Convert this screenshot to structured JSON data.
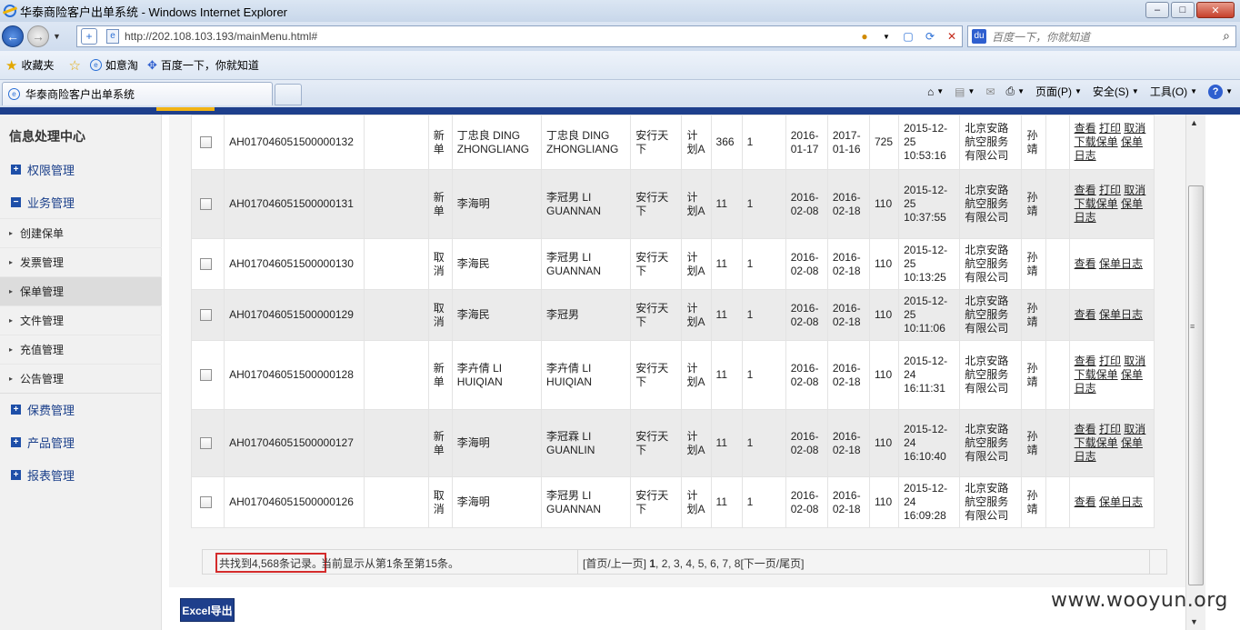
{
  "window": {
    "title": "华泰商险客户出单系统 - Windows Internet Explorer",
    "controls": [
      "–",
      "□",
      "✕"
    ]
  },
  "address_bar": {
    "url": "http://202.108.103.193/mainMenu.html#"
  },
  "search_bar": {
    "placeholder": "百度一下，你就知道"
  },
  "favorites": {
    "favorites_label": "收藏夹",
    "items": [
      "如意淘",
      "百度一下，你就知道"
    ]
  },
  "tabs": {
    "active_tab": "华泰商险客户出单系统"
  },
  "command_bar": {
    "page": "页面(P)",
    "safety": "安全(S)",
    "tools": "工具(O)",
    "help": "?"
  },
  "sidebar": {
    "title": "信息处理中心",
    "groups": [
      {
        "label": "权限管理",
        "icon": "plus"
      },
      {
        "label": "业务管理",
        "icon": "minus"
      }
    ],
    "sub_items": [
      "创建保单",
      "发票管理",
      "保单管理",
      "文件管理",
      "充值管理",
      "公告管理"
    ],
    "active_sub": "保单管理",
    "groups_after": [
      "保费管理",
      "产品管理",
      "报表管理"
    ]
  },
  "table": {
    "rows": [
      {
        "policy_no": "AH017046051500000132",
        "type": "新单",
        "insured": "丁忠良 DING ZHONGLIANG",
        "holder": "丁忠良 DING ZHONGLIANG",
        "product": "安行天下",
        "plan": "计划A",
        "days": "366",
        "count": "1",
        "start": "2016-01-17",
        "end": "2017-01-16",
        "premium": "725",
        "created": "2015-12-25 10:53:16",
        "agency": "北京安路航空服务有限公司",
        "operator": "孙靖",
        "ops": [
          "查看",
          "打印",
          "取消",
          "下载保单",
          "保单日志"
        ]
      },
      {
        "policy_no": "AH017046051500000131",
        "type": "新单",
        "insured": "李海明",
        "holder": "李冠男 LI GUANNAN",
        "product": "安行天下",
        "plan": "计划A",
        "days": "11",
        "count": "1",
        "start": "2016-02-08",
        "end": "2016-02-18",
        "premium": "110",
        "created": "2015-12-25 10:37:55",
        "agency": "北京安路航空服务有限公司",
        "operator": "孙靖",
        "ops": [
          "查看",
          "打印",
          "取消",
          "下载保单",
          "保单日志"
        ]
      },
      {
        "policy_no": "AH017046051500000130",
        "type": "取消",
        "insured": "李海民",
        "holder": "李冠男 LI GUANNAN",
        "product": "安行天下",
        "plan": "计划A",
        "days": "11",
        "count": "1",
        "start": "2016-02-08",
        "end": "2016-02-18",
        "premium": "110",
        "created": "2015-12-25 10:13:25",
        "agency": "北京安路航空服务有限公司",
        "operator": "孙靖",
        "ops": [
          "查看",
          "保单日志"
        ]
      },
      {
        "policy_no": "AH017046051500000129",
        "type": "取消",
        "insured": "李海民",
        "holder": "李冠男",
        "product": "安行天下",
        "plan": "计划A",
        "days": "11",
        "count": "1",
        "start": "2016-02-08",
        "end": "2016-02-18",
        "premium": "110",
        "created": "2015-12-25 10:11:06",
        "agency": "北京安路航空服务有限公司",
        "operator": "孙靖",
        "ops": [
          "查看",
          "保单日志"
        ]
      },
      {
        "policy_no": "AH017046051500000128",
        "type": "新单",
        "insured": "李卉倩 LI HUIQIAN",
        "holder": "李卉倩 LI HUIQIAN",
        "product": "安行天下",
        "plan": "计划A",
        "days": "11",
        "count": "1",
        "start": "2016-02-08",
        "end": "2016-02-18",
        "premium": "110",
        "created": "2015-12-24 16:11:31",
        "agency": "北京安路航空服务有限公司",
        "operator": "孙靖",
        "ops": [
          "查看",
          "打印",
          "取消",
          "下载保单",
          "保单日志"
        ]
      },
      {
        "policy_no": "AH017046051500000127",
        "type": "新单",
        "insured": "李海明",
        "holder": "李冠霖 LI GUANLIN",
        "product": "安行天下",
        "plan": "计划A",
        "days": "11",
        "count": "1",
        "start": "2016-02-08",
        "end": "2016-02-18",
        "premium": "110",
        "created": "2015-12-24 16:10:40",
        "agency": "北京安路航空服务有限公司",
        "operator": "孙靖",
        "ops": [
          "查看",
          "打印",
          "取消",
          "下载保单",
          "保单日志"
        ]
      },
      {
        "policy_no": "AH017046051500000126",
        "type": "取消",
        "insured": "李海明",
        "holder": "李冠男 LI GUANNAN",
        "product": "安行天下",
        "plan": "计划A",
        "days": "11",
        "count": "1",
        "start": "2016-02-08",
        "end": "2016-02-18",
        "premium": "110",
        "created": "2015-12-24 16:09:28",
        "agency": "北京安路航空服务有限公司",
        "operator": "孙靖",
        "ops": [
          "查看",
          "保单日志"
        ]
      }
    ]
  },
  "pager": {
    "total_text": "共找到4,568条记录。",
    "current_text": "当前显示从第1条至第15条。",
    "links_prefix": "[首页/上一页] ",
    "current_page": "1",
    "other_pages": ", 2, 3, 4, 5, 6, 7, 8",
    "links_suffix": "[下一页/尾页]"
  },
  "actions": {
    "excel_export": "Excel导出"
  },
  "watermark": "www.wooyun.org",
  "colors": {
    "header_blue": "#1e3f8c",
    "accent_gold": "#f1b315",
    "highlight_red": "#d42b2b"
  }
}
